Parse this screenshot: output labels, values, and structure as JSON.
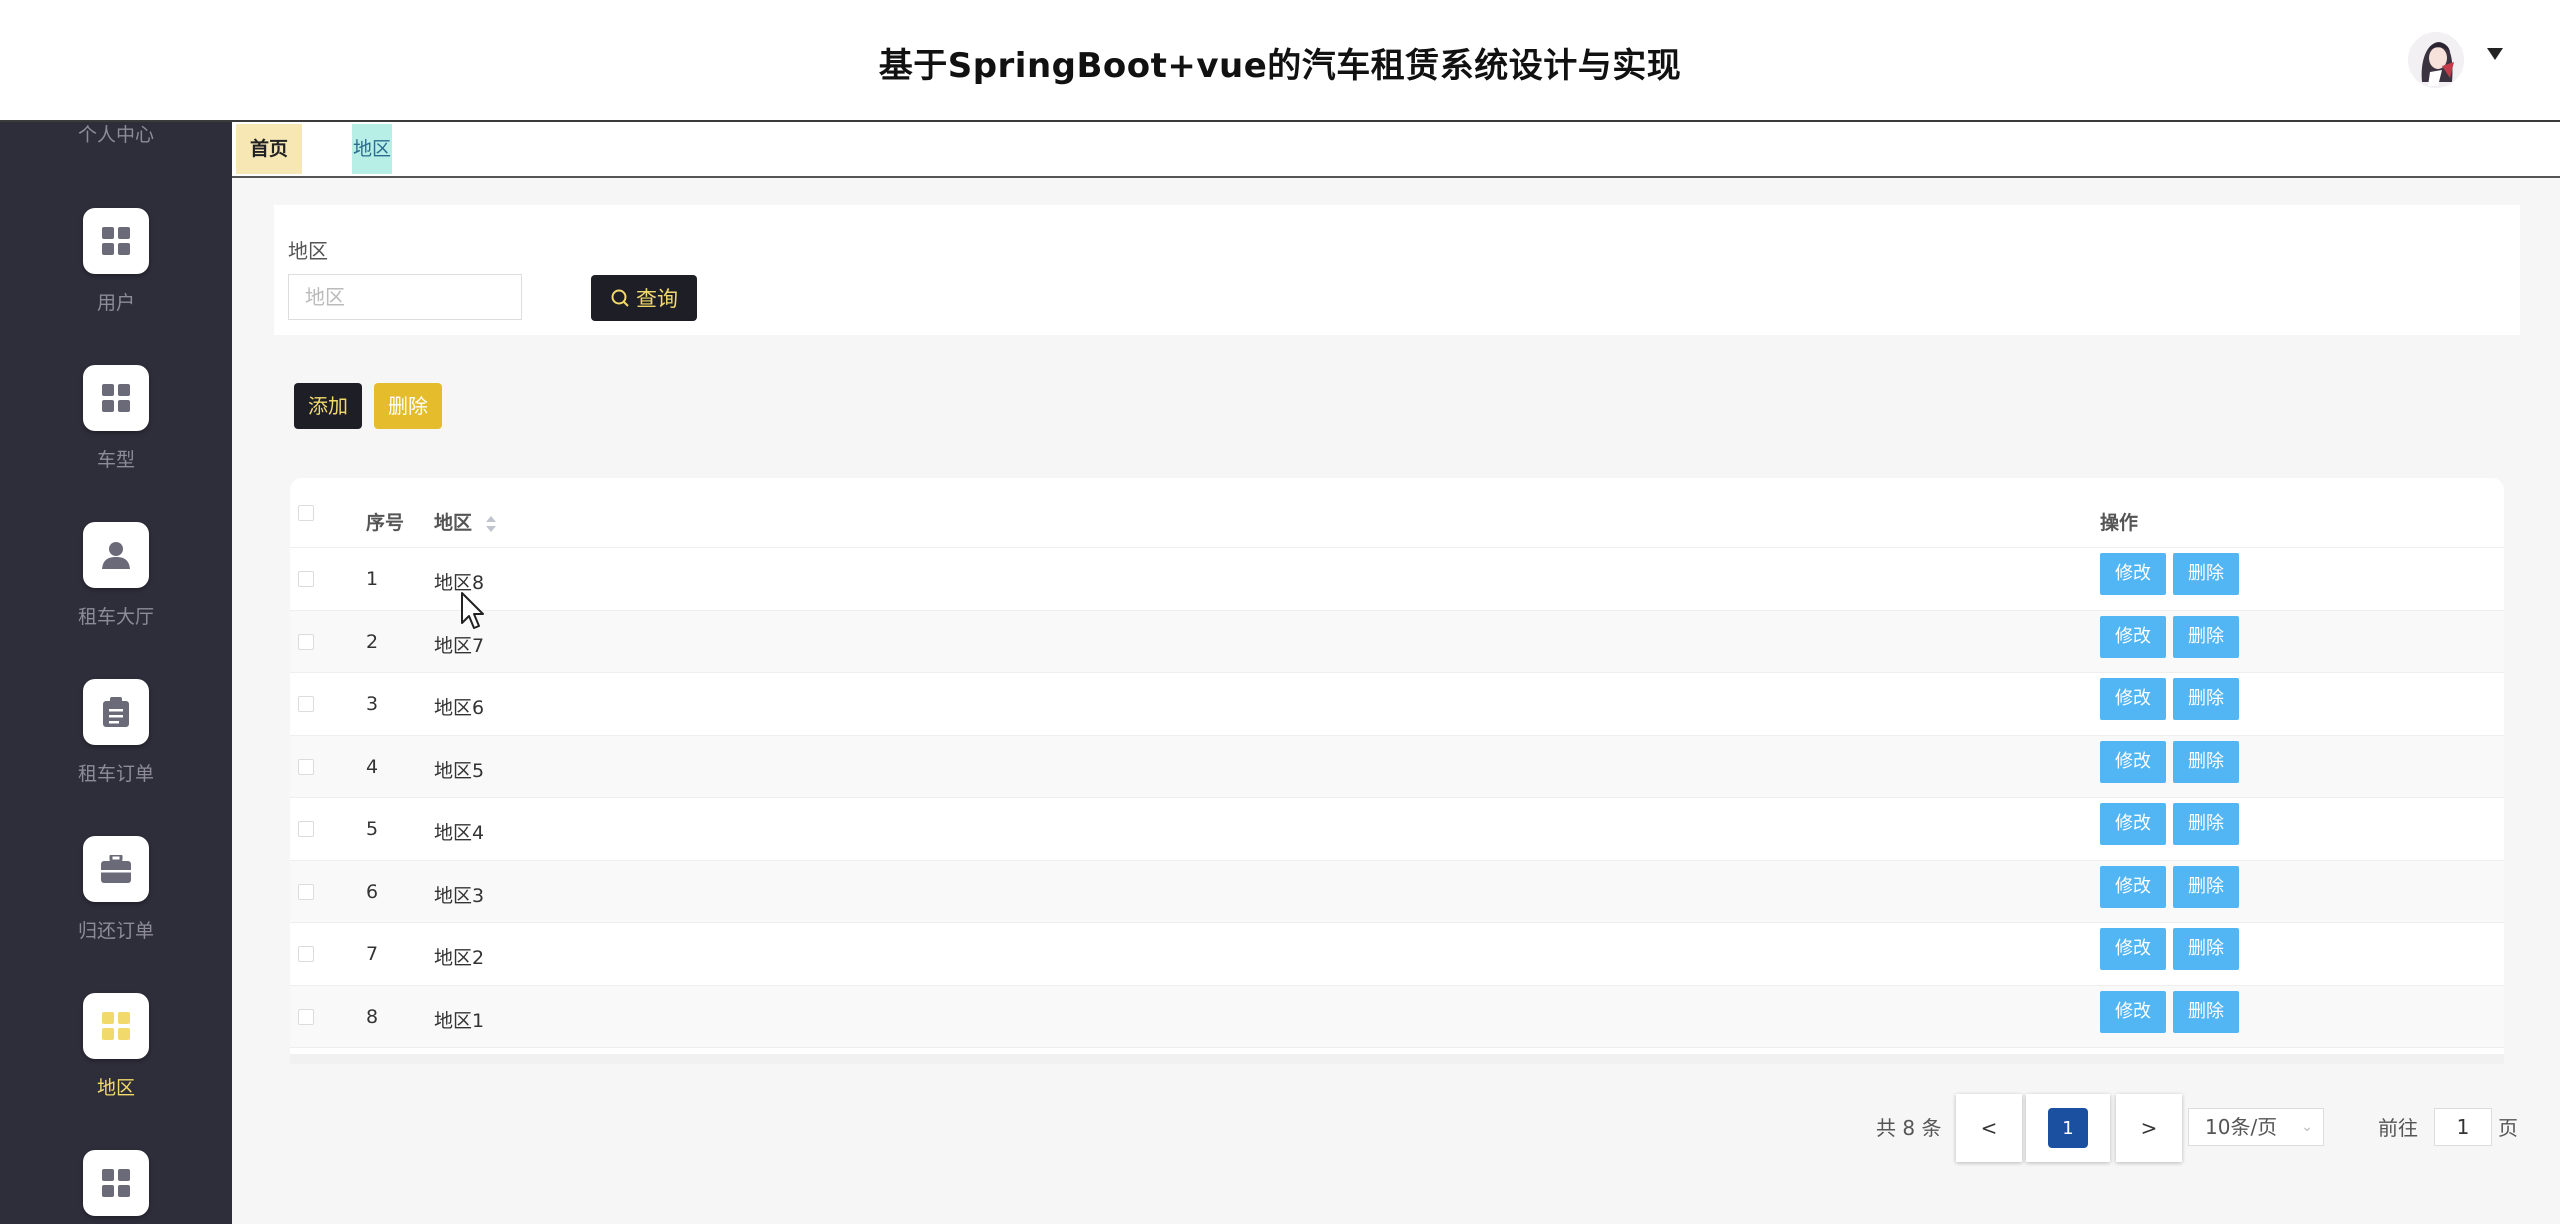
{
  "app": {
    "title": "基于SpringBoot+vue的汽车租赁系统设计与实现"
  },
  "sidebar": {
    "items": [
      {
        "label": "个人中心",
        "icon": "user-circle-icon"
      },
      {
        "label": "用户",
        "icon": "grid-icon"
      },
      {
        "label": "车型",
        "icon": "grid-icon"
      },
      {
        "label": "租车大厅",
        "icon": "user-icon"
      },
      {
        "label": "租车订单",
        "icon": "clipboard-icon"
      },
      {
        "label": "归还订单",
        "icon": "briefcase-icon"
      },
      {
        "label": "地区",
        "icon": "grid-icon",
        "active": true
      },
      {
        "label": "",
        "icon": "grid-icon"
      }
    ]
  },
  "tabs": {
    "home": "首页",
    "current": "地区"
  },
  "search": {
    "label": "地区",
    "placeholder": "地区",
    "button": "查询"
  },
  "actions": {
    "add": "添加",
    "delete": "删除"
  },
  "table": {
    "headers": {
      "index": "序号",
      "region": "地区",
      "operation": "操作"
    },
    "edit_label": "修改",
    "delete_label": "删除",
    "rows": [
      {
        "index": "1",
        "region": "地区8"
      },
      {
        "index": "2",
        "region": "地区7"
      },
      {
        "index": "3",
        "region": "地区6"
      },
      {
        "index": "4",
        "region": "地区5"
      },
      {
        "index": "5",
        "region": "地区4"
      },
      {
        "index": "6",
        "region": "地区3"
      },
      {
        "index": "7",
        "region": "地区2"
      },
      {
        "index": "8",
        "region": "地区1"
      }
    ]
  },
  "pagination": {
    "total": "共 8 条",
    "prev": "<",
    "current_page": "1",
    "next": ">",
    "page_size": "10条/页",
    "goto_prefix": "前往",
    "goto_value": "1",
    "goto_suffix": "页"
  },
  "colors": {
    "sidebar_bg": "#2e2d3a",
    "accent_yellow": "#f2d96b",
    "dark_button": "#1e1e26",
    "op_button": "#52b6f4",
    "page_current": "#1b4fa0"
  }
}
